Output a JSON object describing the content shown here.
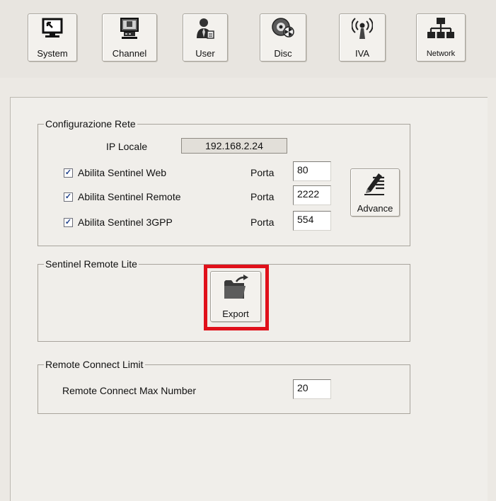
{
  "toolbar": {
    "items": [
      {
        "label": "System"
      },
      {
        "label": "Channel"
      },
      {
        "label": "User"
      },
      {
        "label": "Disc"
      },
      {
        "label": "IVA"
      },
      {
        "label": "Network"
      }
    ]
  },
  "network_config": {
    "legend": "Configurazione Rete",
    "ip_label": "IP Locale",
    "ip_value": "192.168.2.24",
    "port_label": "Porta",
    "rows": [
      {
        "label": "Abilita Sentinel Web",
        "checked": true,
        "port": "80"
      },
      {
        "label": "Abilita Sentinel Remote",
        "checked": true,
        "port": "2222"
      },
      {
        "label": "Abilita Sentinel 3GPP",
        "checked": true,
        "port": "554"
      }
    ],
    "advance_label": "Advance"
  },
  "remote_lite": {
    "legend": "Sentinel Remote Lite",
    "export_label": "Export"
  },
  "connect_limit": {
    "legend": "Remote Connect Limit",
    "max_label": "Remote Connect Max Number",
    "max_value": "20"
  },
  "colors": {
    "highlight": "#e0101a",
    "checkmark": "#1d3f8a"
  }
}
